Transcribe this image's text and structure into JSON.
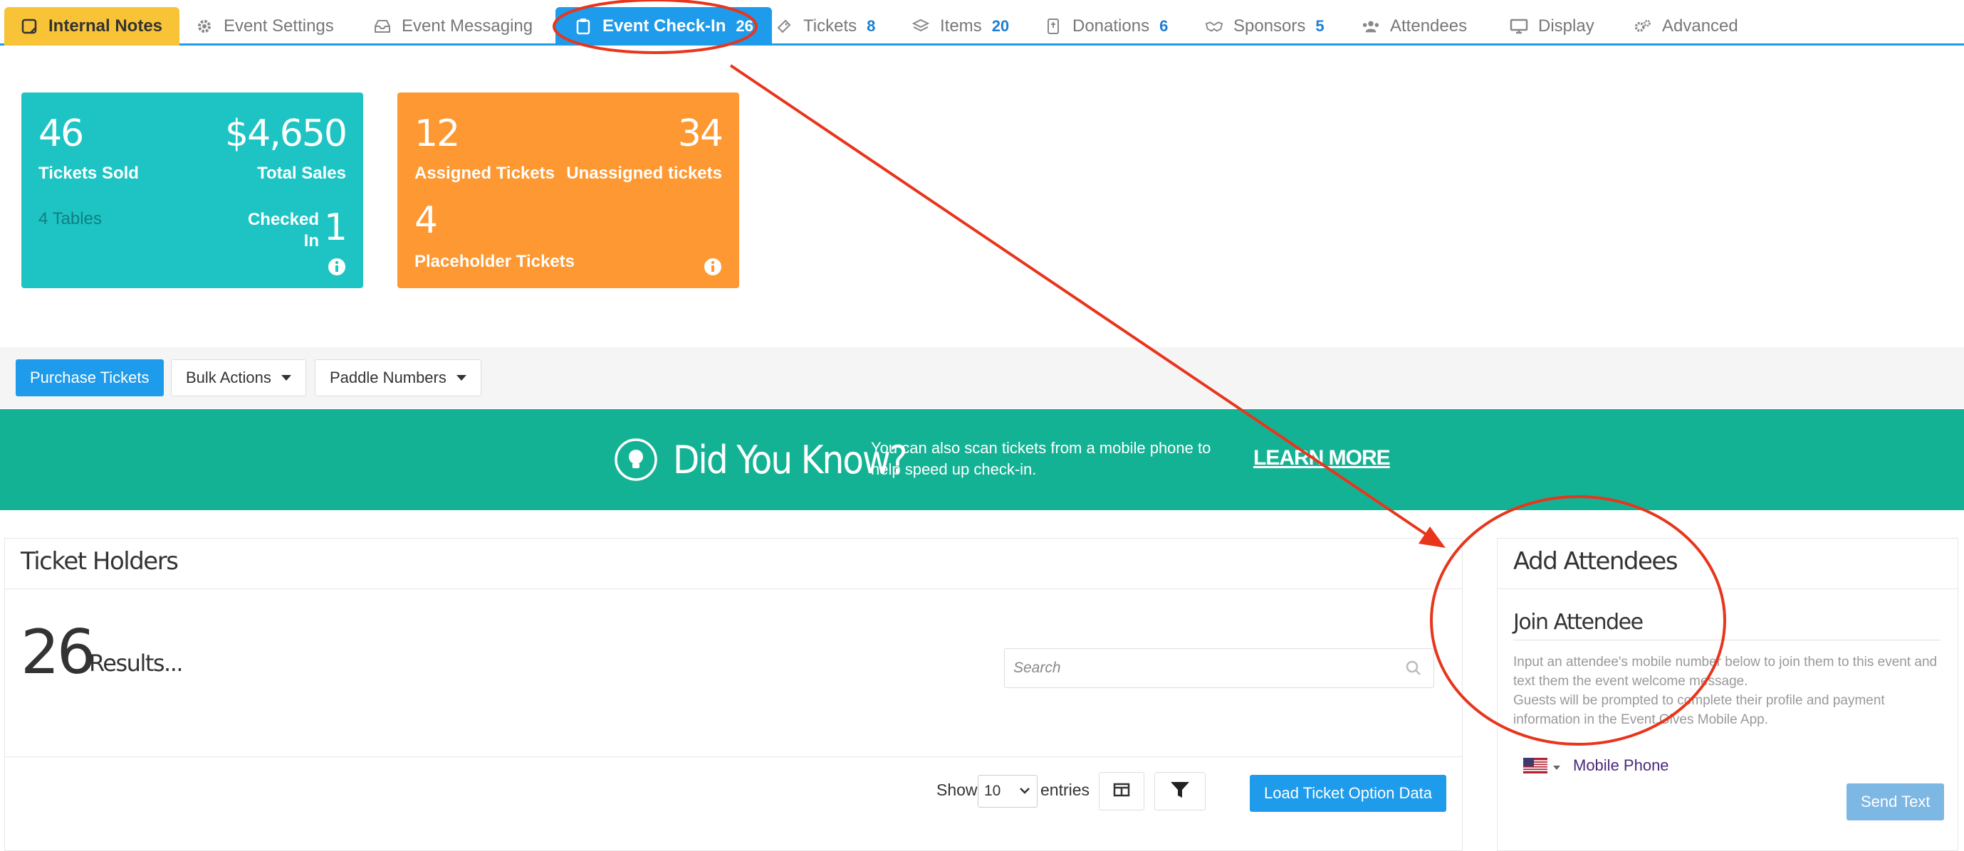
{
  "nav": {
    "tabs": [
      {
        "label": "Internal Notes",
        "icon": "note-icon",
        "badge": ""
      },
      {
        "label": "Event Settings",
        "icon": "gear-icon",
        "badge": ""
      },
      {
        "label": "Event Messaging",
        "icon": "inbox-icon",
        "badge": ""
      },
      {
        "label": "Event Check-In",
        "icon": "clipboard-icon",
        "badge": "26"
      },
      {
        "label": "Tickets",
        "icon": "ticket-icon",
        "badge": "8"
      },
      {
        "label": "Items",
        "icon": "layers-icon",
        "badge": "20"
      },
      {
        "label": "Donations",
        "icon": "donation-icon",
        "badge": "6"
      },
      {
        "label": "Sponsors",
        "icon": "handshake-icon",
        "badge": "5"
      },
      {
        "label": "Attendees",
        "icon": "users-icon",
        "badge": ""
      },
      {
        "label": "Display",
        "icon": "monitor-icon",
        "badge": ""
      },
      {
        "label": "Advanced",
        "icon": "cogs-icon",
        "badge": ""
      }
    ]
  },
  "stats_teal": {
    "tickets_sold_value": "46",
    "tickets_sold_label": "Tickets Sold",
    "total_sales_value": "$4,650",
    "total_sales_label": "Total Sales",
    "tables": "4 Tables",
    "checked_in_label_1": "Checked",
    "checked_in_label_2": "In",
    "checked_in_value": "1",
    "color": "#1ec4c4"
  },
  "stats_orange": {
    "assigned_value": "12",
    "assigned_label": "Assigned Tickets",
    "unassigned_value": "34",
    "unassigned_label": "Unassigned tickets",
    "placeholder_value": "4",
    "placeholder_label": "Placeholder Tickets",
    "color": "#fd9832"
  },
  "toolbar": {
    "purchase_label": "Purchase Tickets",
    "bulk_label": "Bulk Actions",
    "paddle_label": "Paddle Numbers"
  },
  "banner": {
    "heading": "Did You Know?",
    "text": "You can also scan tickets from a mobile phone to help speed up check-in.",
    "link": "LEARN MORE",
    "color": "#14b294"
  },
  "ticket_holders": {
    "title": "Ticket Holders",
    "count": "26",
    "results_label": "Results...",
    "search_placeholder": "Search",
    "show_label": "Show",
    "entries_value": "10",
    "entries_label": "entries",
    "load_button": "Load Ticket Option Data"
  },
  "add_attendees": {
    "title": "Add Attendees",
    "subtitle": "Join Attendee",
    "desc_1": "Input an attendee's mobile number below to join them to this event and text them the event welcome message.",
    "desc_2": "Guests will be prompted to complete their profile and payment information in the Event.Gives Mobile App.",
    "phone_label": "Mobile Phone",
    "send_button": "Send Text"
  },
  "colors": {
    "accent": "#1e9bea",
    "annotation": "#e8351c",
    "notes_tab": "#f9c337"
  }
}
